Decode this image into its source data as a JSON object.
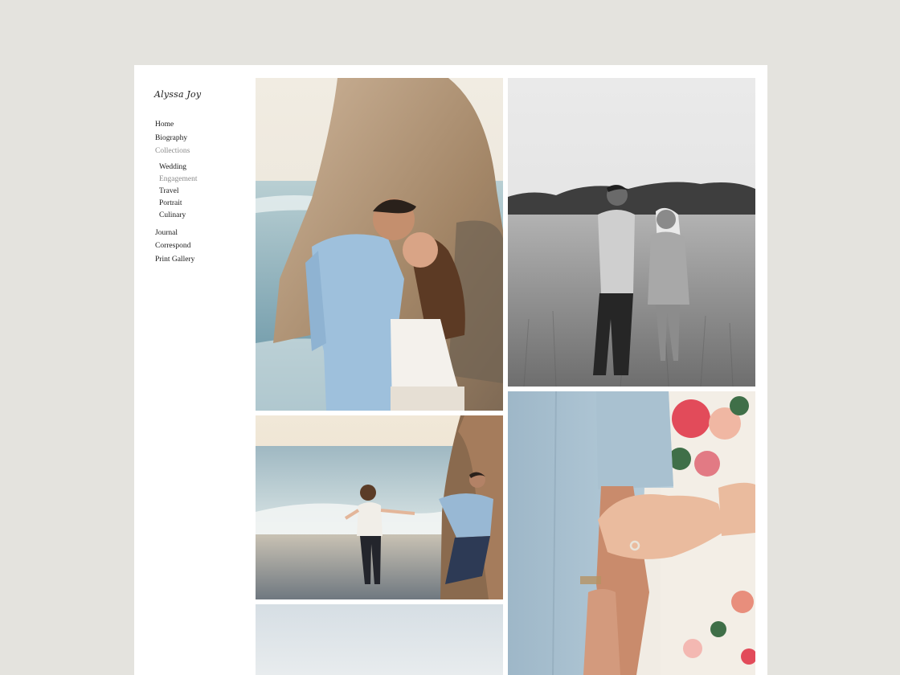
{
  "site": {
    "title": "Alyssa Joy"
  },
  "nav": {
    "home": "Home",
    "biography": "Biography",
    "collections": "Collections",
    "sub": {
      "wedding": "Wedding",
      "engagement": "Engagement",
      "travel": "Travel",
      "portrait": "Portrait",
      "culinary": "Culinary"
    },
    "journal": "Journal",
    "correspond": "Correspond",
    "print_gallery": "Print Gallery"
  },
  "colors": {
    "background": "#e4e3de",
    "page": "#ffffff",
    "text": "#1a1a1a",
    "muted": "#8b8b8b"
  }
}
